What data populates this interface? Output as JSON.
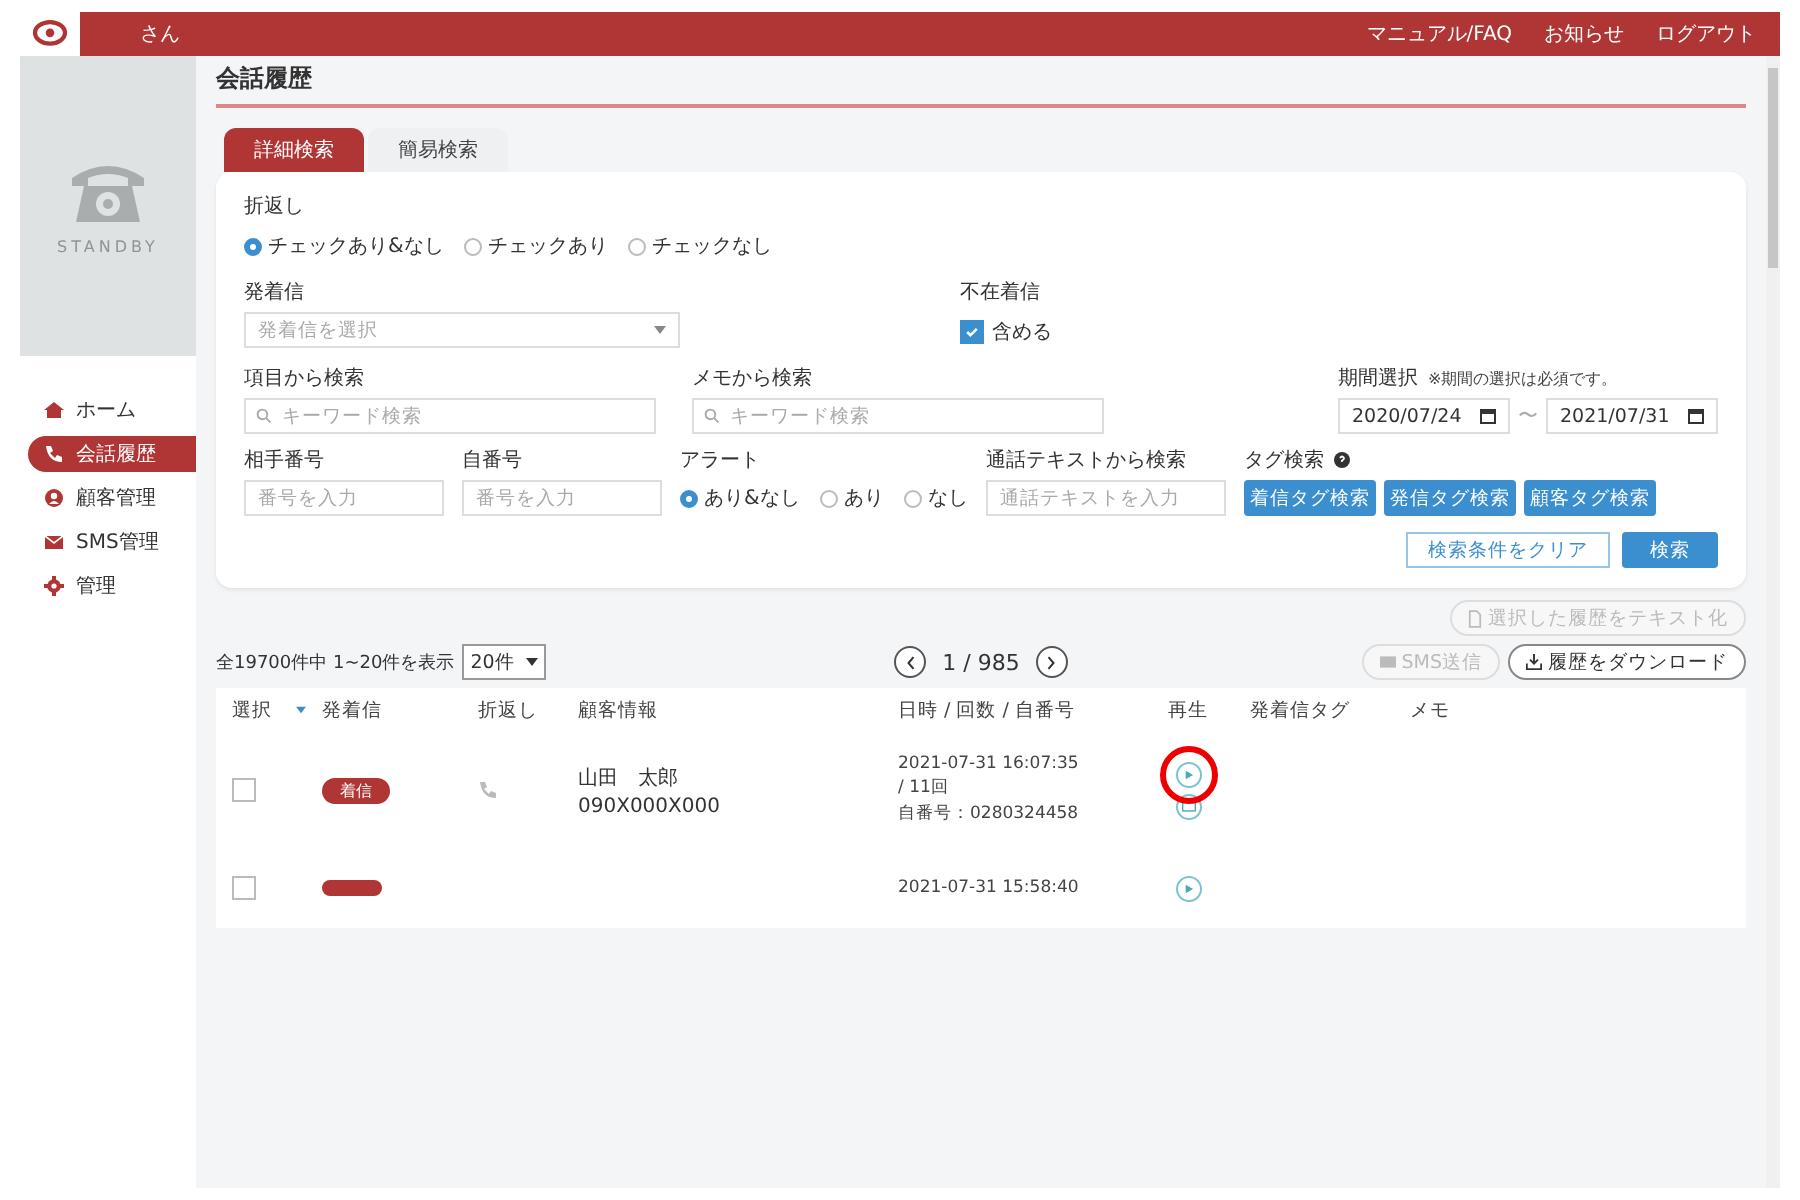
{
  "header": {
    "user": "さん",
    "links": [
      "マニュアル/FAQ",
      "お知らせ",
      "ログアウト"
    ]
  },
  "sidebar": {
    "status": "STANDBY",
    "items": [
      {
        "label": "ホーム",
        "selected": false
      },
      {
        "label": "会話履歴",
        "selected": true
      },
      {
        "label": "顧客管理",
        "selected": false
      },
      {
        "label": "SMS管理",
        "selected": false
      },
      {
        "label": "管理",
        "selected": false
      }
    ]
  },
  "page_title": "会話履歴",
  "tabs": [
    {
      "label": "詳細検索",
      "selected": true
    },
    {
      "label": "簡易検索",
      "selected": false
    }
  ],
  "search": {
    "callback": {
      "label": "折返し",
      "options": [
        {
          "label": "チェックあり&なし",
          "selected": true
        },
        {
          "label": "チェックあり",
          "selected": false
        },
        {
          "label": "チェックなし",
          "selected": false
        }
      ]
    },
    "direction": {
      "label": "発着信",
      "placeholder": "発着信を選択"
    },
    "missed": {
      "label": "不在着信",
      "option": "含める",
      "checked": true
    },
    "item_search": {
      "label": "項目から検索",
      "placeholder": "キーワード検索"
    },
    "memo_search": {
      "label": "メモから検索",
      "placeholder": "キーワード検索"
    },
    "period": {
      "label": "期間選択",
      "note": "※期間の選択は必須です。",
      "from": "2020/07/24",
      "separator": "〜",
      "to": "2021/07/31"
    },
    "partner_number": {
      "label": "相手番号",
      "placeholder": "番号を入力"
    },
    "own_number": {
      "label": "自番号",
      "placeholder": "番号を入力"
    },
    "alert": {
      "label": "アラート",
      "options": [
        {
          "label": "あり&なし",
          "selected": true
        },
        {
          "label": "あり",
          "selected": false
        },
        {
          "label": "なし",
          "selected": false
        }
      ]
    },
    "text_search": {
      "label": "通話テキストから検索",
      "placeholder": "通話テキストを入力"
    },
    "tag_search": {
      "label": "タグ検索",
      "buttons": [
        "着信タグ検索",
        "発信タグ検索",
        "顧客タグ検索"
      ]
    },
    "clear_button": "検索条件をクリア",
    "search_button": "検索"
  },
  "list": {
    "text_button": {
      "label": "選択した履歴をテキスト化",
      "disabled": true
    },
    "summary": "全19700件中 1~20件を表示",
    "page_size": "20件",
    "pager": "1 / 985",
    "sms_button": {
      "label": "SMS送信",
      "disabled": true
    },
    "download_button": {
      "label": "履歴をダウンロード",
      "disabled": false
    }
  },
  "table": {
    "columns": [
      "選択",
      "発着信",
      "折返し",
      "顧客情報",
      "日時 / 回数 / 自番号",
      "再生",
      "発着信タグ",
      "メモ"
    ],
    "rows": [
      {
        "checked": false,
        "badge": "着信",
        "name": "山田　太郎",
        "phone": "090X000X000",
        "datetime": "2021-07-31 16:07:35",
        "count": "/ 11回",
        "own_number": "自番号：0280324458",
        "highlighted": true
      },
      {
        "checked": false,
        "datetime": "2021-07-31 15:58:40",
        "highlighted": false
      }
    ]
  }
}
